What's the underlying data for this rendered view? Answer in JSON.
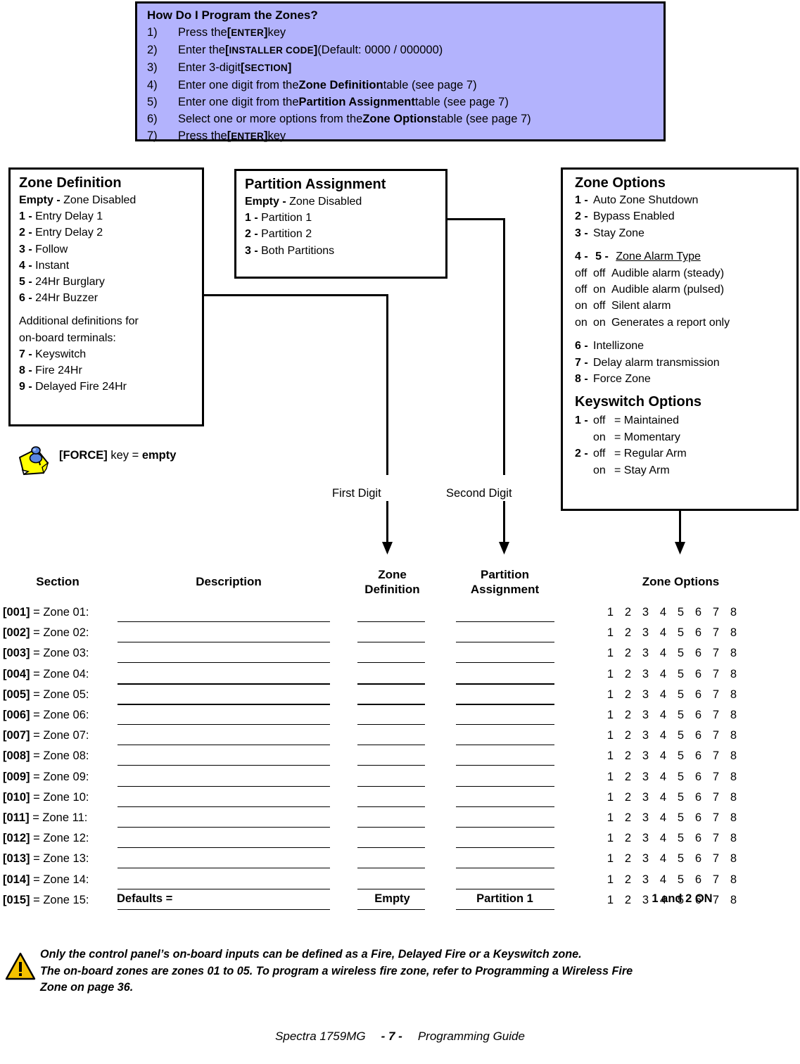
{
  "howto": {
    "title": "How Do I Program the Zones?",
    "steps": [
      {
        "num": "1)",
        "pre": "Press the ",
        "key": "[ENTER]",
        "post": " key"
      },
      {
        "num": "2)",
        "pre": "Enter the ",
        "key": "[INSTALLER CODE]",
        "post": " (Default: 0000 / 000000)"
      },
      {
        "num": "3)",
        "pre": "Enter 3-digit ",
        "key": "[SECTION]",
        "post": ""
      },
      {
        "num": "4)",
        "pre": "Enter one digit from the ",
        "key": "Zone Definition",
        "post": " table (see page 7)"
      },
      {
        "num": "5)",
        "pre": "Enter one digit from the ",
        "key": "Partition Assignment",
        "post": " table (see page 7)"
      },
      {
        "num": "6)",
        "pre": "Select one or more options from the ",
        "key": "Zone Options",
        "post": " table (see page 7)"
      },
      {
        "num": "7)",
        "pre": "Press the ",
        "key": "[ENTER]",
        "post": " key"
      }
    ]
  },
  "zone_definition": {
    "title": "Zone Definition",
    "items": [
      {
        "key": "Empty -",
        "label": " Zone Disabled"
      },
      {
        "key": "1 -",
        "label": " Entry Delay 1"
      },
      {
        "key": "2 -",
        "label": " Entry Delay 2"
      },
      {
        "key": "3 -",
        "label": " Follow"
      },
      {
        "key": "4 -",
        "label": " Instant"
      },
      {
        "key": "5 -",
        "label": " 24Hr Burglary"
      },
      {
        "key": "6 -",
        "label": " 24Hr Buzzer"
      }
    ],
    "note_line1": "Additional definitions for",
    "note_line2": "on-board terminals:",
    "extra_items": [
      {
        "key": "7 -",
        "label": " Keyswitch"
      },
      {
        "key": "8 -",
        "label": " Fire 24Hr"
      },
      {
        "key": "9 -",
        "label": " Delayed Fire 24Hr"
      }
    ]
  },
  "partition_assignment": {
    "title": "Partition Assignment",
    "items": [
      {
        "key": "Empty -",
        "label": " Zone Disabled"
      },
      {
        "key": "1 -",
        "label": " Partition 1"
      },
      {
        "key": "2 -",
        "label": " Partition 2"
      },
      {
        "key": "3 -",
        "label": " Both Partitions"
      }
    ]
  },
  "zone_options": {
    "title": "Zone Options",
    "items": [
      {
        "key": "1 -",
        "label": "Auto Zone Shutdown"
      },
      {
        "key": "2 -",
        "label": "Bypass Enabled"
      },
      {
        "key": "3 -",
        "label": "Stay Zone"
      }
    ],
    "alarm_header": {
      "k1": "4 -",
      "k2": "5 -",
      "label": "Zone Alarm Type"
    },
    "alarm_rows": [
      {
        "d4": "off",
        "d5": "off",
        "label": "Audible alarm (steady)"
      },
      {
        "d4": "off",
        "d5": "on",
        "label": "Audible alarm (pulsed)"
      },
      {
        "d4": "on",
        "d5": "off",
        "label": "Silent alarm"
      },
      {
        "d4": "on",
        "d5": "on",
        "label": "Generates a report only"
      }
    ],
    "items2": [
      {
        "key": "6 -",
        "label": "Intellizone"
      },
      {
        "key": "7 -",
        "label": "Delay alarm transmission"
      },
      {
        "key": "8 -",
        "label": "Force Zone"
      }
    ],
    "keyswitch_title": "Keyswitch Options",
    "keyswitch_rows": [
      {
        "key": "1 -",
        "state": "off",
        "label": "= Maintained"
      },
      {
        "key": "",
        "state": "on",
        "label": "= Momentary"
      },
      {
        "key": "2 -",
        "state": "off",
        "label": "= Regular Arm"
      },
      {
        "key": "",
        "state": "on",
        "label": "= Stay Arm"
      }
    ]
  },
  "force_note": {
    "icon": "sticky-note-pin-icon",
    "key": "[FORCE]",
    "mid": " key = ",
    "value": "empty"
  },
  "connectors": {
    "first_digit_label": "First Digit",
    "second_digit_label": "Second Digit"
  },
  "table": {
    "headers": {
      "section": "Section",
      "description": "Description",
      "zone_definition_l1": "Zone",
      "zone_definition_l2": "Definition",
      "partition_l1": "Partition",
      "partition_l2": "Assignment",
      "zone_options": "Zone Options"
    },
    "option_numbers": [
      "1",
      "2",
      "3",
      "4",
      "5",
      "6",
      "7",
      "8"
    ],
    "rows": [
      {
        "section": "[001]",
        "eq": " = ",
        "name": "Zone 01:"
      },
      {
        "section": "[002]",
        "eq": " = ",
        "name": "Zone 02:"
      },
      {
        "section": "[003]",
        "eq": " = ",
        "name": "Zone 03:"
      },
      {
        "section": "[004]",
        "eq": " = ",
        "name": "Zone 04:"
      },
      {
        "section": "[005]",
        "eq": " = ",
        "name": "Zone 05:"
      },
      {
        "section": "[006]",
        "eq": " = ",
        "name": "Zone 06:"
      },
      {
        "section": "[007]",
        "eq": " = ",
        "name": "Zone 07:"
      },
      {
        "section": "[008]",
        "eq": " = ",
        "name": "Zone 08:"
      },
      {
        "section": "[009]",
        "eq": " = ",
        "name": "Zone 09:"
      },
      {
        "section": "[010]",
        "eq": " = ",
        "name": "Zone 10:"
      },
      {
        "section": "[011]",
        "eq": " = ",
        "name": "Zone 11:"
      },
      {
        "section": "[012]",
        "eq": " = ",
        "name": "Zone 12:"
      },
      {
        "section": "[013]",
        "eq": " = ",
        "name": "Zone 13:"
      },
      {
        "section": "[014]",
        "eq": " = ",
        "name": "Zone 14:"
      },
      {
        "section": "[015]",
        "eq": " = ",
        "name": "Zone 15:"
      }
    ],
    "defaults": {
      "label": "Defaults =",
      "zone_definition": "Empty",
      "partition": "Partition 1",
      "zone_options": "1 and 2 ON"
    }
  },
  "warning": {
    "icon": "warning-triangle-icon",
    "line1": "Only the control panel’s on-board inputs can be defined as a Fire, Delayed Fire or a Keyswitch zone.",
    "line2": "The on-board zones are zones 01 to 05. To program a wireless fire zone, refer to Programming a Wireless Fire",
    "line3": "Zone on page 36."
  },
  "footer": {
    "product": "Spectra 1759MG",
    "page": "- 7 -",
    "guide": "Programming Guide"
  },
  "colors": {
    "instruction_box_bg": "#b3b3fd",
    "sticky_note": "#ffff00",
    "pin": "#4a78d8",
    "warning_triangle": "#f5c200"
  }
}
